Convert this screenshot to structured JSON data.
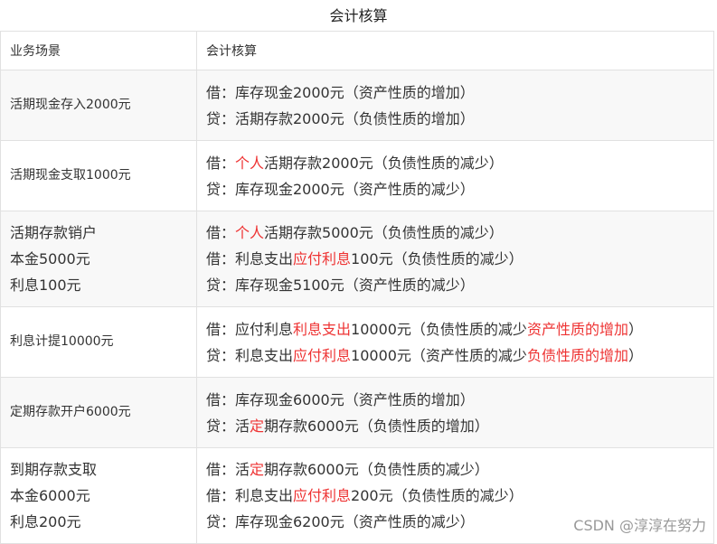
{
  "caption": "会计核算",
  "header": {
    "col1": "业务场景",
    "col2": "会计核算"
  },
  "rows": [
    {
      "scene": [
        "活期现金存入2000元"
      ],
      "entries": [
        [
          {
            "t": "借：库存现金2000元（资产性质的增加）"
          }
        ],
        [
          {
            "t": "贷：活期存款2000元（负债性质的增加）"
          }
        ]
      ]
    },
    {
      "scene": [
        "活期现金支取1000元"
      ],
      "entries": [
        [
          {
            "t": "借："
          },
          {
            "t": "个人",
            "red": true
          },
          {
            "t": "活期存款2000元（负债性质的减少）"
          }
        ],
        [
          {
            "t": "贷：库存现金2000元（资产性质的减少）"
          }
        ]
      ]
    },
    {
      "scene": [
        "活期存款销户",
        "本金5000元",
        "利息100元"
      ],
      "entries": [
        [
          {
            "t": "借："
          },
          {
            "t": "个人",
            "red": true
          },
          {
            "t": "活期存款5000元（负债性质的减少）"
          }
        ],
        [
          {
            "t": "借：利息支出"
          },
          {
            "t": "应付利息",
            "red": true
          },
          {
            "t": "100元（负债性质的减少）"
          }
        ],
        [
          {
            "t": "贷：库存现金5100元（资产性质的减少）"
          }
        ]
      ]
    },
    {
      "scene": [
        "利息计提10000元"
      ],
      "entries": [
        [
          {
            "t": "借：应付利息"
          },
          {
            "t": "利息支出",
            "red": true
          },
          {
            "t": "10000元（负债性质的减少"
          },
          {
            "t": "资产性质的增加",
            "red": true
          },
          {
            "t": "）"
          }
        ],
        [
          {
            "t": "贷：利息支出"
          },
          {
            "t": "应付利息",
            "red": true
          },
          {
            "t": "10000元（资产性质的减少"
          },
          {
            "t": "负债性质的增加",
            "red": true
          },
          {
            "t": "）"
          }
        ]
      ]
    },
    {
      "scene": [
        "定期存款开户6000元"
      ],
      "entries": [
        [
          {
            "t": "借：库存现金6000元（资产性质的增加）"
          }
        ],
        [
          {
            "t": "贷：活"
          },
          {
            "t": "定",
            "red": true
          },
          {
            "t": "期存款6000元（负债性质的增加）"
          }
        ]
      ]
    },
    {
      "scene": [
        "到期存款支取",
        "本金6000元",
        "利息200元"
      ],
      "entries": [
        [
          {
            "t": "借：活"
          },
          {
            "t": "定",
            "red": true
          },
          {
            "t": "期存款6000元（负债性质的减少）"
          }
        ],
        [
          {
            "t": "借：利息支出"
          },
          {
            "t": "应付利息",
            "red": true
          },
          {
            "t": "200元（负债性质的减少）"
          }
        ],
        [
          {
            "t": "贷：库存现金6200元（资产性质的减少）"
          }
        ]
      ]
    }
  ],
  "watermark": "CSDN @淳淳在努力",
  "colors": {
    "highlight": "#e33333",
    "border": "#e1e1e1",
    "alt_row": "#f8f8f8"
  }
}
